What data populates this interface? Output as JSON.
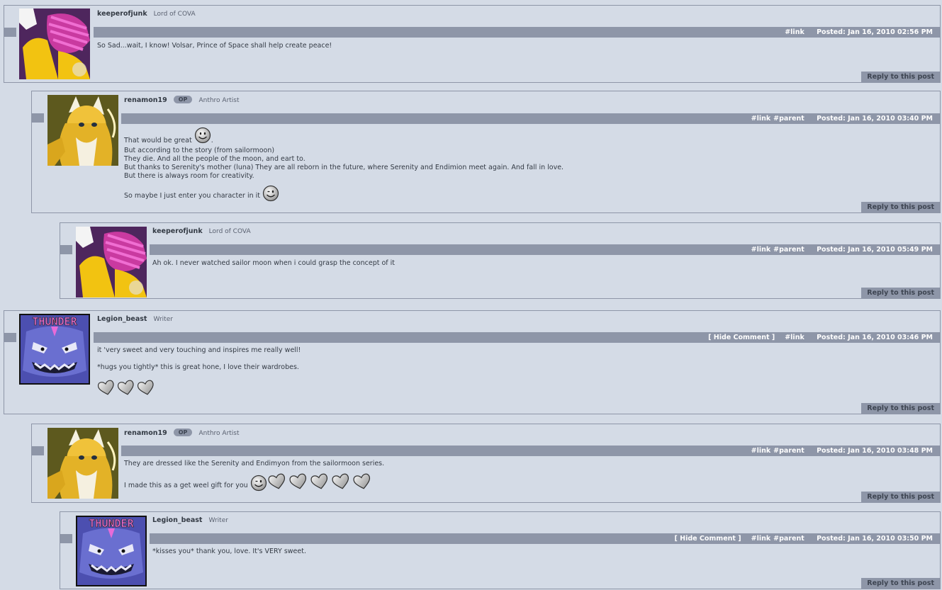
{
  "comments": [
    {
      "user": "keeperofjunk",
      "op": "",
      "title": "Lord of COVA",
      "hide": "",
      "links": [
        "#link"
      ],
      "posted": "Posted: Jan 16, 2010 02:56 PM",
      "lines": [
        "So Sad...wait, I know! Volsar, Prince of Space shall help create peace!"
      ],
      "reply": "Reply to this post"
    },
    {
      "user": "renamon19",
      "op": "OP",
      "title": "Anthro Artist",
      "hide": "",
      "links": [
        "#link",
        "#parent"
      ],
      "posted": "Posted: Jan 16, 2010 03:40 PM",
      "lines": [
        "That would be great",
        "But according to the story (from sailormoon)",
        "They die. And all the people of the moon, and eart to.",
        "But thanks to Serenity's mother (luna) They are all reborn in the future, where Serenity and Endimion meet again. And fall in love.",
        "But there is always room for creativity.",
        "So maybe I just enter you character in it"
      ],
      "reply": "Reply to this post"
    },
    {
      "user": "keeperofjunk",
      "op": "",
      "title": "Lord of COVA",
      "hide": "",
      "links": [
        "#link",
        "#parent"
      ],
      "posted": "Posted: Jan 16, 2010 05:49 PM",
      "lines": [
        "Ah ok. I never watched sailor moon when i could grasp the concept of it"
      ],
      "reply": "Reply to this post"
    },
    {
      "user": "Legion_beast",
      "op": "",
      "title": "Writer",
      "hide": "[ Hide Comment ]",
      "links": [
        "#link"
      ],
      "posted": "Posted: Jan 16, 2010 03:46 PM",
      "lines": [
        "it 'very sweet and very touching and inspires me really well!",
        "*hugs you tightly* this is great hone, I love their wardrobes."
      ],
      "reply": "Reply to this post"
    },
    {
      "user": "renamon19",
      "op": "OP",
      "title": "Anthro Artist",
      "hide": "",
      "links": [
        "#link",
        "#parent"
      ],
      "posted": "Posted: Jan 16, 2010 03:48 PM",
      "lines": [
        "They are dressed like the Serenity and Endimyon from the sailormoon series.",
        "I made this as a get weel gift for you"
      ],
      "reply": "Reply to this post"
    },
    {
      "user": "Legion_beast",
      "op": "",
      "title": "Writer",
      "hide": "[ Hide Comment ]",
      "links": [
        "#link",
        "#parent"
      ],
      "posted": "Posted: Jan 16, 2010 03:50 PM",
      "lines": [
        "*kisses you* thank you, love. It's VERY sweet."
      ],
      "reply": "Reply to this post"
    }
  ],
  "icons": {
    "smiley": "smiley-emoticon-icon",
    "wink": "wink-emoticon-icon",
    "heart": "heart-emoticon-icon"
  },
  "avatar_text": "THUNDER",
  "colors": {
    "background": "#d4dbe6",
    "bar": "#8e96a8",
    "border": "#8e96a8"
  }
}
